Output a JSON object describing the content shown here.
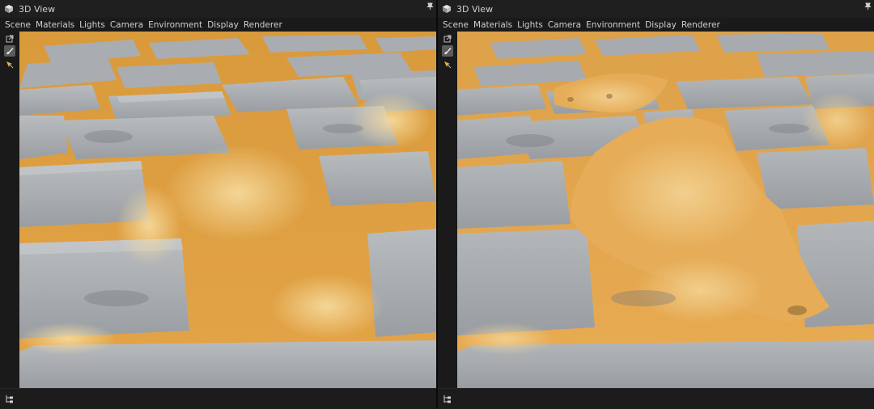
{
  "panels": [
    {
      "title": "3D View",
      "menu": [
        "Scene",
        "Materials",
        "Lights",
        "Camera",
        "Environment",
        "Display",
        "Renderer"
      ],
      "tools": [
        "popout-icon",
        "paint-brush-icon",
        "pick-arrow-icon"
      ]
    },
    {
      "title": "3D View",
      "menu": [
        "Scene",
        "Materials",
        "Lights",
        "Camera",
        "Environment",
        "Display",
        "Renderer"
      ],
      "tools": [
        "popout-icon",
        "paint-brush-icon",
        "pick-arrow-icon"
      ]
    }
  ],
  "colors": {
    "sand": "#e0a247",
    "sand_light": "#f0cd86",
    "stone": "#aeb1b4",
    "stone_dark": "#808488",
    "chrome": "#1a1a1a"
  }
}
